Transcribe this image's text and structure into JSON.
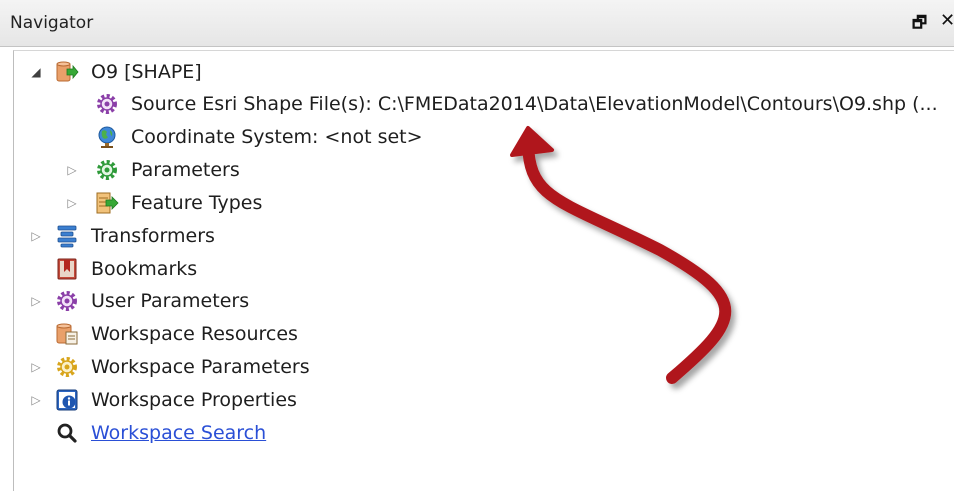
{
  "panel": {
    "title": "Navigator",
    "restore_glyph": "🗗",
    "close_glyph": "✕"
  },
  "tree": {
    "dataset": {
      "label": "O9 [SHAPE]",
      "icon": "shape-reader-icon",
      "children": {
        "source": {
          "label": "Source Esri Shape File(s): C:\\FMEData2014\\Data\\ElevationModel\\Contours\\O9.shp (...",
          "icon": "purple-gear-icon"
        },
        "coordsys": {
          "label": "Coordinate System: <not set>",
          "icon": "globe-icon"
        },
        "parameters": {
          "label": "Parameters",
          "icon": "green-gear-icon"
        },
        "feature_types": {
          "label": "Feature Types",
          "icon": "feature-types-icon"
        }
      }
    },
    "transformers": {
      "label": "Transformers",
      "icon": "transformers-icon"
    },
    "bookmarks": {
      "label": "Bookmarks",
      "icon": "bookmark-icon"
    },
    "user_parameters": {
      "label": "User Parameters",
      "icon": "purple-gear-icon"
    },
    "workspace_resources": {
      "label": "Workspace Resources",
      "icon": "resources-icon"
    },
    "workspace_parameters": {
      "label": "Workspace Parameters",
      "icon": "yellow-gear-icon"
    },
    "workspace_properties": {
      "label": "Workspace Properties",
      "icon": "info-icon"
    },
    "workspace_search": {
      "label": "Workspace Search",
      "icon": "search-icon"
    }
  },
  "colors": {
    "link": "#2a4fd6",
    "annotation_arrow": "#b0181c"
  }
}
